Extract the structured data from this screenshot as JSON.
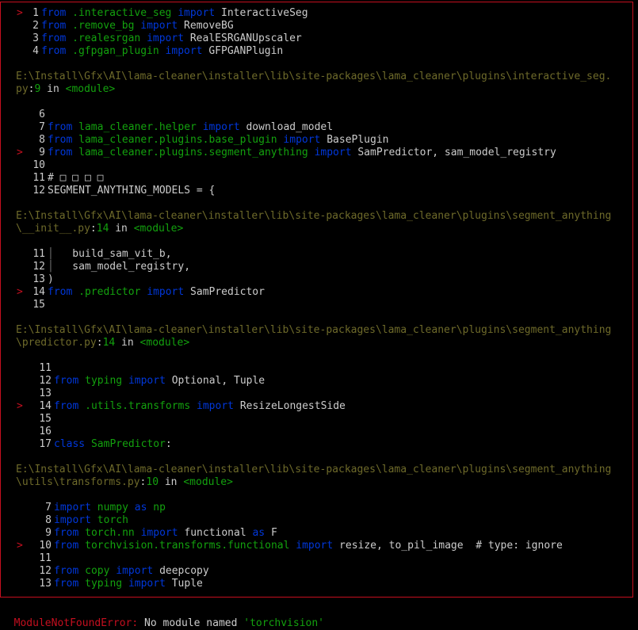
{
  "frames": [
    {
      "lines": [
        {
          "n": "1",
          "marker": true,
          "tokens": [
            [
              "kw",
              "from"
            ],
            [
              "t",
              " "
            ],
            [
              "fn",
              ".interactive_seg"
            ],
            [
              "t",
              " "
            ],
            [
              "kw",
              "import"
            ],
            [
              "t",
              " InteractiveSeg"
            ]
          ]
        },
        {
          "n": "2",
          "marker": false,
          "tokens": [
            [
              "kw",
              "from"
            ],
            [
              "t",
              " "
            ],
            [
              "fn",
              ".remove_bg"
            ],
            [
              "t",
              " "
            ],
            [
              "kw",
              "import"
            ],
            [
              "t",
              " RemoveBG"
            ]
          ]
        },
        {
          "n": "3",
          "marker": false,
          "tokens": [
            [
              "kw",
              "from"
            ],
            [
              "t",
              " "
            ],
            [
              "fn",
              ".realesrgan"
            ],
            [
              "t",
              " "
            ],
            [
              "kw",
              "import"
            ],
            [
              "t",
              " RealESRGANUpscaler"
            ]
          ]
        },
        {
          "n": "4",
          "marker": false,
          "tokens": [
            [
              "kw",
              "from"
            ],
            [
              "t",
              " "
            ],
            [
              "fn",
              ".gfpgan_plugin"
            ],
            [
              "t",
              " "
            ],
            [
              "kw",
              "import"
            ],
            [
              "t",
              " GFPGANPlugin"
            ]
          ]
        }
      ]
    },
    {
      "header_path_1": "E:\\Install\\Gfx\\AI\\lama-cleaner\\installer\\lib\\site-packages\\lama_cleaner\\plugins\\interactive_seg.",
      "header_path_2": "py",
      "header_lineno": "9",
      "header_in": " in ",
      "header_module": "<module>",
      "lines": [
        {
          "n": "6",
          "marker": false,
          "tokens": []
        },
        {
          "n": "7",
          "marker": false,
          "tokens": [
            [
              "kw",
              "from"
            ],
            [
              "t",
              " "
            ],
            [
              "fn",
              "lama_cleaner.helper"
            ],
            [
              "t",
              " "
            ],
            [
              "kw",
              "import"
            ],
            [
              "t",
              " download_model"
            ]
          ]
        },
        {
          "n": "8",
          "marker": false,
          "tokens": [
            [
              "kw",
              "from"
            ],
            [
              "t",
              " "
            ],
            [
              "fn",
              "lama_cleaner.plugins.base_plugin"
            ],
            [
              "t",
              " "
            ],
            [
              "kw",
              "import"
            ],
            [
              "t",
              " BasePlugin"
            ]
          ]
        },
        {
          "n": "9",
          "marker": true,
          "tokens": [
            [
              "kw",
              "from"
            ],
            [
              "t",
              " "
            ],
            [
              "fn",
              "lama_cleaner.plugins.segment_anything"
            ],
            [
              "t",
              " "
            ],
            [
              "kw",
              "import"
            ],
            [
              "t",
              " SamPredictor, sam_model_registry"
            ]
          ]
        },
        {
          "n": "10",
          "marker": false,
          "tokens": []
        },
        {
          "n": "11",
          "marker": false,
          "tokens": [
            [
              "t",
              "# □ □ □ □"
            ]
          ]
        },
        {
          "n": "12",
          "marker": false,
          "tokens": [
            [
              "t",
              "SEGMENT_ANYTHING_MODELS = {"
            ]
          ]
        }
      ]
    },
    {
      "header_path_1": "E:\\Install\\Gfx\\AI\\lama-cleaner\\installer\\lib\\site-packages\\lama_cleaner\\plugins\\segment_anything",
      "header_path_2": "\\__init__.py",
      "header_lineno": "14",
      "header_in": " in ",
      "header_module": "<module>",
      "lines": [
        {
          "n": "11",
          "marker": false,
          "tokens": [
            [
              "p",
              "│"
            ],
            [
              "t",
              "   build_sam_vit_b,"
            ]
          ]
        },
        {
          "n": "12",
          "marker": false,
          "tokens": [
            [
              "p",
              "│"
            ],
            [
              "t",
              "   sam_model_registry,"
            ]
          ]
        },
        {
          "n": "13",
          "marker": false,
          "tokens": [
            [
              "t",
              ")"
            ]
          ]
        },
        {
          "n": "14",
          "marker": true,
          "tokens": [
            [
              "kw",
              "from"
            ],
            [
              "t",
              " "
            ],
            [
              "fn",
              ".predictor"
            ],
            [
              "t",
              " "
            ],
            [
              "kw",
              "import"
            ],
            [
              "t",
              " SamPredictor"
            ]
          ]
        },
        {
          "n": "15",
          "marker": false,
          "tokens": []
        }
      ]
    },
    {
      "header_path_1": "E:\\Install\\Gfx\\AI\\lama-cleaner\\installer\\lib\\site-packages\\lama_cleaner\\plugins\\segment_anything",
      "header_path_2": "\\predictor.py",
      "header_lineno": "14",
      "header_in": " in ",
      "header_module": "<module>",
      "lines": [
        {
          "n": "11",
          "marker": false,
          "tokens": []
        },
        {
          "n": "12",
          "marker": false,
          "tokens": [
            [
              "kw",
              "from"
            ],
            [
              "t",
              " "
            ],
            [
              "fn",
              "typing"
            ],
            [
              "t",
              " "
            ],
            [
              "kw",
              "import"
            ],
            [
              "t",
              " Optional, Tuple"
            ]
          ]
        },
        {
          "n": "13",
          "marker": false,
          "tokens": []
        },
        {
          "n": "14",
          "marker": true,
          "tokens": [
            [
              "kw",
              "from"
            ],
            [
              "t",
              " "
            ],
            [
              "fn",
              ".utils.transforms"
            ],
            [
              "t",
              " "
            ],
            [
              "kw",
              "import"
            ],
            [
              "t",
              " ResizeLongestSide"
            ]
          ]
        },
        {
          "n": "15",
          "marker": false,
          "tokens": []
        },
        {
          "n": "16",
          "marker": false,
          "tokens": []
        },
        {
          "n": "17",
          "marker": false,
          "tokens": [
            [
              "kw",
              "class"
            ],
            [
              "t",
              " "
            ],
            [
              "fn",
              "SamPredictor"
            ],
            [
              "t",
              ":"
            ]
          ]
        }
      ]
    },
    {
      "header_path_1": "E:\\Install\\Gfx\\AI\\lama-cleaner\\installer\\lib\\site-packages\\lama_cleaner\\plugins\\segment_anything",
      "header_path_2": "\\utils\\transforms.py",
      "header_lineno": "10",
      "header_in": " in ",
      "header_module": "<module>",
      "lines": [
        {
          "n": "7",
          "marker": false,
          "tokens": [
            [
              "kw",
              "import"
            ],
            [
              "t",
              " "
            ],
            [
              "fn",
              "numpy"
            ],
            [
              "t",
              " "
            ],
            [
              "kw",
              "as"
            ],
            [
              "t",
              " "
            ],
            [
              "fn",
              "np"
            ]
          ]
        },
        {
          "n": "8",
          "marker": false,
          "tokens": [
            [
              "kw",
              "import"
            ],
            [
              "t",
              " "
            ],
            [
              "fn",
              "torch"
            ]
          ]
        },
        {
          "n": "9",
          "marker": false,
          "tokens": [
            [
              "kw",
              "from"
            ],
            [
              "t",
              " "
            ],
            [
              "fn",
              "torch.nn"
            ],
            [
              "t",
              " "
            ],
            [
              "kw",
              "import"
            ],
            [
              "t",
              " functional "
            ],
            [
              "kw",
              "as"
            ],
            [
              "t",
              " F"
            ]
          ]
        },
        {
          "n": "10",
          "marker": true,
          "tokens": [
            [
              "kw",
              "from"
            ],
            [
              "t",
              " "
            ],
            [
              "fn",
              "torchvision.transforms.functional"
            ],
            [
              "t",
              " "
            ],
            [
              "kw",
              "import"
            ],
            [
              "t",
              " resize, to_pil_image  # type: ignore"
            ]
          ]
        },
        {
          "n": "11",
          "marker": false,
          "tokens": []
        },
        {
          "n": "12",
          "marker": false,
          "tokens": [
            [
              "kw",
              "from"
            ],
            [
              "t",
              " "
            ],
            [
              "fn",
              "copy"
            ],
            [
              "t",
              " "
            ],
            [
              "kw",
              "import"
            ],
            [
              "t",
              " deepcopy"
            ]
          ]
        },
        {
          "n": "13",
          "marker": false,
          "tokens": [
            [
              "kw",
              "from"
            ],
            [
              "t",
              " "
            ],
            [
              "fn",
              "typing"
            ],
            [
              "t",
              " "
            ],
            [
              "kw",
              "import"
            ],
            [
              "t",
              " Tuple"
            ]
          ]
        }
      ]
    }
  ],
  "marker_glyph": ">",
  "error": {
    "type": "ModuleNotFoundError",
    "colon": ":",
    "message": " No module named ",
    "module": "'torchvision'"
  },
  "colors": {
    "keyword": "#0037da",
    "name": "#13a10e",
    "path": "#6e6a2a",
    "error": "#c50f1f",
    "text": "#cccccc",
    "background": "#000000"
  }
}
